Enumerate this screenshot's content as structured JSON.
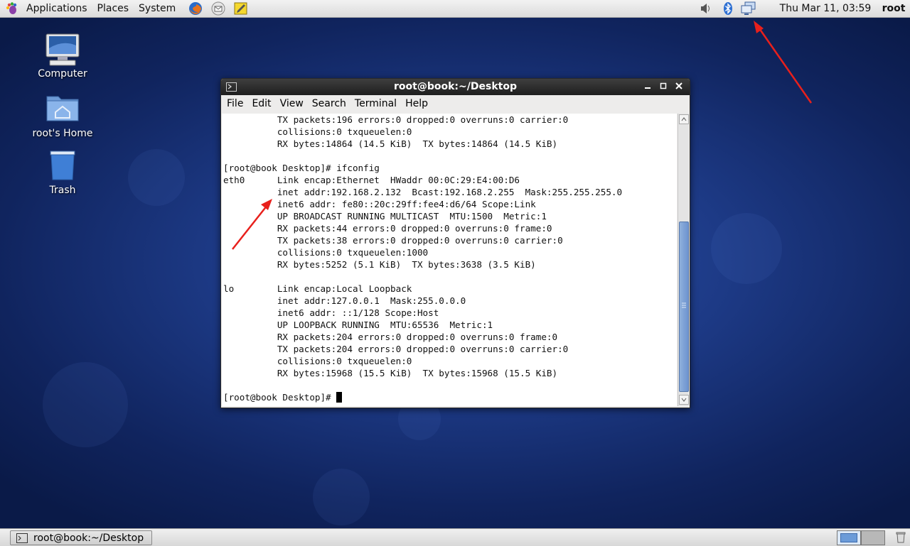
{
  "top_panel": {
    "menus": [
      "Applications",
      "Places",
      "System"
    ],
    "launchers": [
      "firefox-icon",
      "mail-icon",
      "notes-icon"
    ],
    "clock": "Thu Mar 11, 03:59",
    "user": "root"
  },
  "desktop": {
    "icons": [
      {
        "label": "Computer",
        "icon": "computer-icon"
      },
      {
        "label": "root's Home",
        "icon": "home-folder-icon"
      },
      {
        "label": "Trash",
        "icon": "trash-icon"
      }
    ]
  },
  "terminal": {
    "title": "root@book:~/Desktop",
    "menus": [
      "File",
      "Edit",
      "View",
      "Search",
      "Terminal",
      "Help"
    ],
    "lines": [
      "          TX packets:196 errors:0 dropped:0 overruns:0 carrier:0",
      "          collisions:0 txqueuelen:0",
      "          RX bytes:14864 (14.5 KiB)  TX bytes:14864 (14.5 KiB)",
      "",
      "[root@book Desktop]# ifconfig",
      "eth0      Link encap:Ethernet  HWaddr 00:0C:29:E4:00:D6",
      "          inet addr:192.168.2.132  Bcast:192.168.2.255  Mask:255.255.255.0",
      "          inet6 addr: fe80::20c:29ff:fee4:d6/64 Scope:Link",
      "          UP BROADCAST RUNNING MULTICAST  MTU:1500  Metric:1",
      "          RX packets:44 errors:0 dropped:0 overruns:0 frame:0",
      "          TX packets:38 errors:0 dropped:0 overruns:0 carrier:0",
      "          collisions:0 txqueuelen:1000",
      "          RX bytes:5252 (5.1 KiB)  TX bytes:3638 (3.5 KiB)",
      "",
      "lo        Link encap:Local Loopback",
      "          inet addr:127.0.0.1  Mask:255.0.0.0",
      "          inet6 addr: ::1/128 Scope:Host",
      "          UP LOOPBACK RUNNING  MTU:65536  Metric:1",
      "          RX packets:204 errors:0 dropped:0 overruns:0 frame:0",
      "          TX packets:204 errors:0 dropped:0 overruns:0 carrier:0",
      "          collisions:0 txqueuelen:0",
      "          RX bytes:15968 (15.5 KiB)  TX bytes:15968 (15.5 KiB)",
      ""
    ],
    "prompt": "[root@book Desktop]# "
  },
  "taskbar": {
    "task_label": "root@book:~/Desktop"
  },
  "colors": {
    "annotation_arrow": "#e8201c",
    "desktop_blue": "#1d3a86"
  }
}
